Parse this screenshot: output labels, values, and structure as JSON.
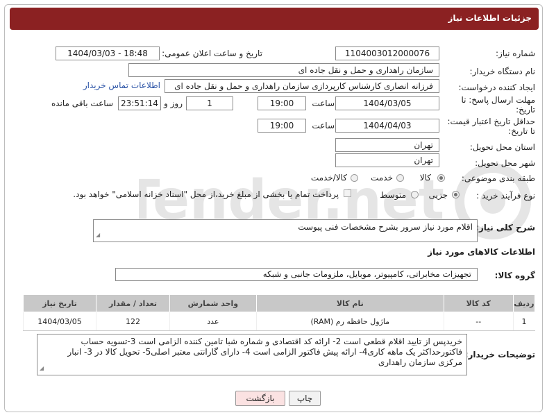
{
  "header": {
    "title": "جزئیات اطلاعات نیاز"
  },
  "fields": {
    "need_number": {
      "label": "شماره نیاز:",
      "value": "1104003012000076"
    },
    "announce_datetime": {
      "label": "تاریخ و ساعت اعلان عمومی:",
      "value": "1404/03/03 - 18:48"
    },
    "buyer_org": {
      "label": "نام دستگاه خریدار:",
      "value": "سازمان راهداری و حمل و نقل جاده ای"
    },
    "creator": {
      "label": "ایجاد کننده درخواست:",
      "value": "فرزانه انصاری کارشناس کارپردازی سازمان راهداری و حمل و نقل جاده ای",
      "contact_link": "اطلاعات تماس خریدار"
    },
    "response_deadline": {
      "label_line1": "مهلت ارسال پاسخ: تا",
      "label_line2": "تاریخ:",
      "date": "1404/03/05",
      "time_label": "ساعت",
      "time": "19:00",
      "days": "1",
      "days_label": "روز و",
      "remaining": "23:51:14",
      "remaining_label": "ساعت باقی مانده"
    },
    "price_validity": {
      "label_line1": "حداقل تاریخ اعتبار قیمت:",
      "label_line2": "تا تاریخ:",
      "date": "1404/04/03",
      "time_label": "ساعت",
      "time": "19:00"
    },
    "delivery_province": {
      "label": "استان محل تحویل:",
      "value": "تهران"
    },
    "delivery_city": {
      "label": "شهر محل تحویل:",
      "value": "تهران"
    },
    "category": {
      "label": "طبقه بندی موضوعی:",
      "options": [
        "کالا",
        "خدمت",
        "کالا/خدمت"
      ],
      "selected": "کالا"
    },
    "purchase_type": {
      "label": "نوع فرآیند خرید :",
      "options": [
        "جزیی",
        "متوسط"
      ],
      "selected": "جزیی",
      "payment_note": "پرداخت تمام یا بخشی از مبلغ خرید،از محل \"اسناد خزانه اسلامی\" خواهد بود."
    }
  },
  "general_description": {
    "label": "شرح کلی نیاز:",
    "value": "اقلام مورد نیاز سرور بشرح مشخصات فنی پیوست"
  },
  "goods_section": {
    "title": "اطلاعات کالاهای مورد نیاز",
    "group_label": "گروه کالا:",
    "group_value": "تجهیزات مخابراتی، کامپیوتر، موبایل، ملزومات جانبی و شبکه"
  },
  "table": {
    "headers": [
      "ردیف",
      "کد کالا",
      "نام کالا",
      "واحد شمارش",
      "تعداد / مقدار",
      "تاریخ نیاز"
    ],
    "rows": [
      [
        "1",
        "--",
        "ماژول حافظه رم (RAM)",
        "عدد",
        "122",
        "1404/03/05"
      ]
    ]
  },
  "buyer_notes": {
    "label": "توضیحات خریدار:",
    "value": "خریدپس از تایید اقلام قطعی است  2- ارائه کد اقتصادی و شماره شبا تامین کننده الزامی است 3-تسویه حساب فاکتورحداکثر یک ماهه کاری4- ارائه پیش فاکتور الزامی است 4- دارای گارانتی معتبر اصلی5- تحویل کالا در 3- انبار مرکزی سازمان راهداری"
  },
  "buttons": {
    "print": "چاپ",
    "back": "بازگشت"
  },
  "watermark": "AriaTender.net"
}
